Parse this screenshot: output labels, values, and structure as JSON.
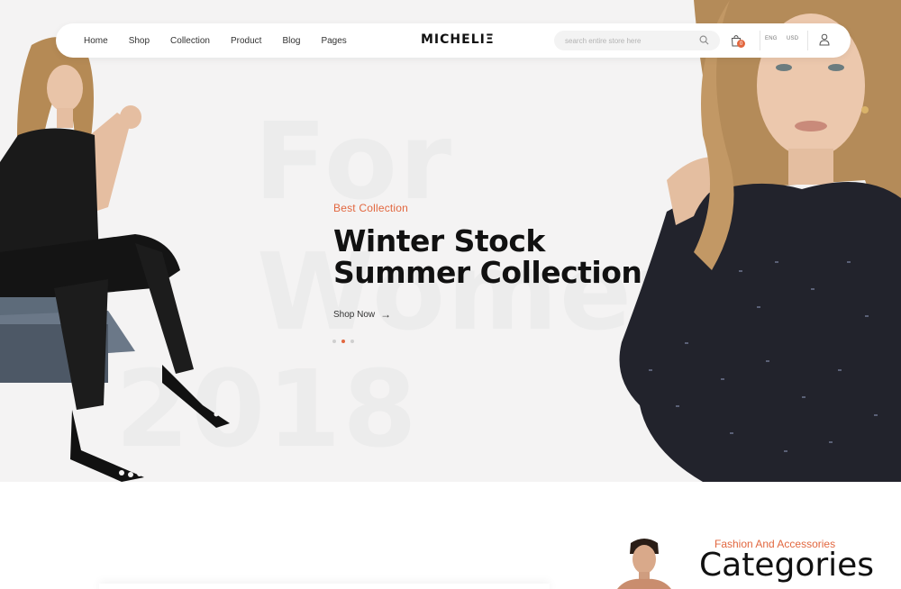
{
  "nav": {
    "links": [
      "Home",
      "Shop",
      "Collection",
      "Product",
      "Blog",
      "Pages"
    ],
    "brand": "MICHELIΞ",
    "search_placeholder": "search entire store here",
    "cart_count": "0",
    "language": "ENG",
    "currency": "USD"
  },
  "hero": {
    "background_words": [
      "For",
      "Women",
      "2018"
    ],
    "eyebrow": "Best Collection",
    "headline": "Winter Stock Summer Collection",
    "cta": "Shop Now",
    "slide_count": 3,
    "active_slide": 2
  },
  "categories": {
    "eyebrow": "Fashion And Accessories",
    "title": "Categories"
  },
  "colors": {
    "accent": "#e2673f",
    "hero_bg": "#f4f3f3"
  }
}
